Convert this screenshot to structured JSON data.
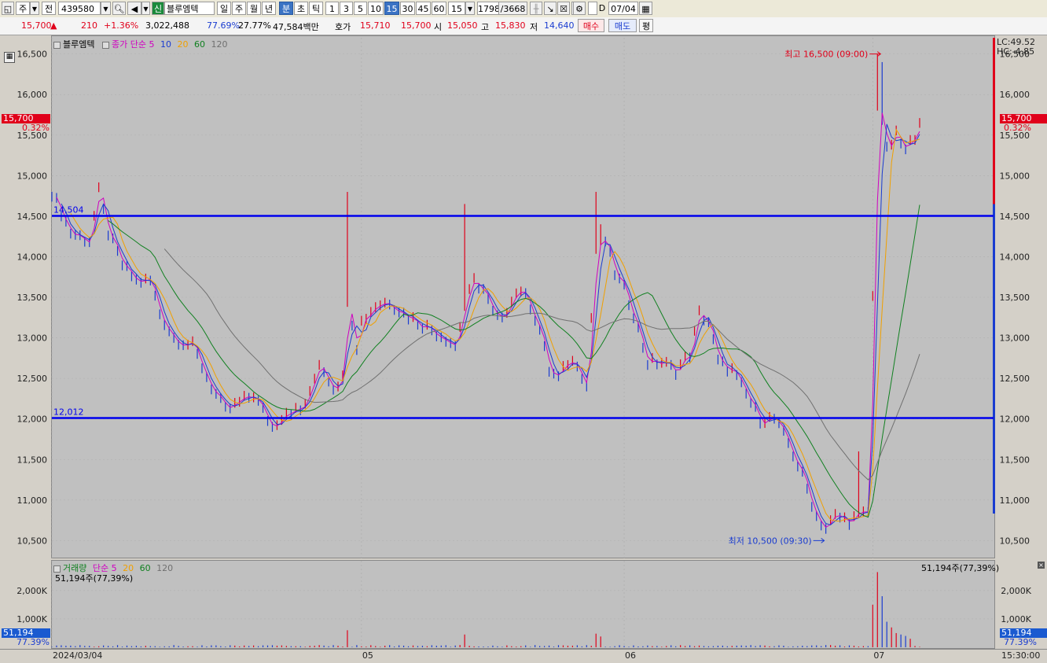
{
  "toolbar": {
    "market": "주",
    "type": "전",
    "code": "439580",
    "credit_badge": "신",
    "stock_name": "블루엠텍",
    "periods": [
      "일",
      "주",
      "월",
      "년",
      "분",
      "초",
      "틱"
    ],
    "minutes": [
      "1",
      "3",
      "5",
      "10",
      "15",
      "30",
      "45",
      "60"
    ],
    "minute_value": "15",
    "count": "1798",
    "total": "/3668",
    "d_label": "D",
    "date": "07/04"
  },
  "quote": {
    "price": "15,700",
    "change": "210",
    "change_pct": "+1.36%",
    "volume": "3,022,488",
    "vol_ratio": "77.69%",
    "turnover": "27.77%",
    "amount": "47,584백만",
    "bid_label": "호가",
    "bid1": "15,710",
    "bid2": "15,700",
    "open_label": "시",
    "open": "15,050",
    "high_label": "고",
    "high": "15,830",
    "low_label": "저",
    "low": "14,640",
    "buy_label": "매수",
    "sell_label": "매도",
    "flat_label": "평"
  },
  "price_legend": {
    "name": "블루엠텍",
    "label": "종가 단순",
    "mas": [
      "5",
      "10",
      "20",
      "60",
      "120"
    ],
    "ma_colors": [
      "#d000c0",
      "#1a3cd0",
      "#f0a000",
      "#108020",
      "#707070"
    ]
  },
  "volume_legend": {
    "name": "거래량",
    "label": "단순",
    "mas": [
      "5",
      "20",
      "60",
      "120"
    ],
    "ma_colors": [
      "#d000c0",
      "#f0a000",
      "#108020",
      "#707070"
    ],
    "current": "51,194주(77,39%)"
  },
  "right_info": {
    "lc": "LC:49.52",
    "hc": "HC:-4.85"
  },
  "current_tag": {
    "price": "15,700",
    "pct": "0.32%"
  },
  "volume_tag": {
    "value": "51,194",
    "pct": "77.39%"
  },
  "time_label": "15:30:00",
  "chart_data": [
    {
      "type": "line",
      "title": "블루엠텍",
      "ylim": [
        10300,
        16700
      ],
      "yticks": [
        "16,500",
        "16,000",
        "15,500",
        "15,000",
        "14,500",
        "14,000",
        "13,500",
        "13,000",
        "12,500",
        "12,000",
        "11,500",
        "11,000",
        "10,500"
      ],
      "ytick_values": [
        16500,
        16000,
        15500,
        15000,
        14500,
        14000,
        13500,
        13000,
        12500,
        12000,
        11500,
        11000,
        10500
      ],
      "x_labels": [
        {
          "label": "2024/03/04",
          "i": 0
        },
        {
          "label": "05",
          "i": 66
        },
        {
          "label": "06",
          "i": 122
        },
        {
          "label": "07",
          "i": 175
        }
      ],
      "n_points": 186,
      "anchors": [
        [
          0,
          14800
        ],
        [
          4,
          14300
        ],
        [
          8,
          14200
        ],
        [
          10,
          14800
        ],
        [
          12,
          14300
        ],
        [
          15,
          13900
        ],
        [
          18,
          13700
        ],
        [
          21,
          13700
        ],
        [
          23,
          13300
        ],
        [
          26,
          13000
        ],
        [
          30,
          12900
        ],
        [
          34,
          12400
        ],
        [
          37,
          12100
        ],
        [
          40,
          12200
        ],
        [
          43,
          12300
        ],
        [
          45,
          12100
        ],
        [
          47,
          11900
        ],
        [
          50,
          12100
        ],
        [
          53,
          12100
        ],
        [
          55,
          12300
        ],
        [
          57,
          12700
        ],
        [
          60,
          12400
        ],
        [
          62,
          12500
        ],
        [
          63,
          13500
        ],
        [
          65,
          12900
        ],
        [
          66,
          13200
        ],
        [
          69,
          13400
        ],
        [
          72,
          13450
        ],
        [
          75,
          13300
        ],
        [
          78,
          13200
        ],
        [
          81,
          13100
        ],
        [
          84,
          13000
        ],
        [
          86,
          12900
        ],
        [
          88,
          13400
        ],
        [
          90,
          13700
        ],
        [
          92,
          13600
        ],
        [
          94,
          13300
        ],
        [
          96,
          13200
        ],
        [
          98,
          13500
        ],
        [
          100,
          13600
        ],
        [
          102,
          13400
        ],
        [
          104,
          13100
        ],
        [
          106,
          12600
        ],
        [
          108,
          12500
        ],
        [
          110,
          12700
        ],
        [
          112,
          12700
        ],
        [
          114,
          12400
        ],
        [
          116,
          14100
        ],
        [
          118,
          14200
        ],
        [
          120,
          13800
        ],
        [
          122,
          13600
        ],
        [
          124,
          13300
        ],
        [
          127,
          12700
        ],
        [
          130,
          12700
        ],
        [
          133,
          12600
        ],
        [
          136,
          12800
        ],
        [
          138,
          13300
        ],
        [
          140,
          13200
        ],
        [
          142,
          12700
        ],
        [
          145,
          12600
        ],
        [
          148,
          12300
        ],
        [
          151,
          12000
        ],
        [
          154,
          12000
        ],
        [
          157,
          11700
        ],
        [
          160,
          11300
        ],
        [
          163,
          10800
        ],
        [
          165,
          10650
        ],
        [
          167,
          10800
        ],
        [
          170,
          10750
        ],
        [
          172,
          10800
        ],
        [
          174,
          10850
        ],
        [
          175,
          13500
        ],
        [
          176,
          15900
        ],
        [
          177,
          15700
        ],
        [
          178,
          15300
        ],
        [
          180,
          15500
        ],
        [
          182,
          15300
        ],
        [
          184,
          15500
        ],
        [
          185,
          15700
        ]
      ],
      "spikes": [
        {
          "i": 63,
          "high": 14800
        },
        {
          "i": 88,
          "high": 14650
        },
        {
          "i": 116,
          "high": 14800
        },
        {
          "i": 117,
          "high": 14400
        },
        {
          "i": 176,
          "high": 16500
        },
        {
          "i": 177,
          "high": 16400
        },
        {
          "i": 172,
          "high": 11600
        }
      ],
      "lines": [
        {
          "value": 14504,
          "label": "14,504"
        },
        {
          "value": 12012,
          "label": "12,012"
        }
      ],
      "annotations": [
        {
          "text": "최고 16,500 (09:00)",
          "i": 177,
          "value": 16500
        },
        {
          "text": "최저 10,500 (09:30)",
          "i": 165,
          "value": 10500
        }
      ],
      "ma_periods": [
        5,
        10,
        20,
        60,
        120
      ]
    },
    {
      "type": "bar",
      "title": "거래량",
      "ylim": [
        0,
        2800
      ],
      "yticks": [
        "2,000K",
        "1,000K"
      ],
      "ytick_values": [
        2000,
        1000
      ],
      "baseline": 80,
      "spikes": [
        {
          "i": 63,
          "v": 600
        },
        {
          "i": 88,
          "v": 450
        },
        {
          "i": 116,
          "v": 480
        },
        {
          "i": 117,
          "v": 380
        },
        {
          "i": 175,
          "v": 1500
        },
        {
          "i": 176,
          "v": 2650
        },
        {
          "i": 177,
          "v": 1800
        },
        {
          "i": 178,
          "v": 900
        },
        {
          "i": 179,
          "v": 700
        },
        {
          "i": 180,
          "v": 500
        },
        {
          "i": 181,
          "v": 450
        },
        {
          "i": 182,
          "v": 400
        },
        {
          "i": 183,
          "v": 300
        }
      ]
    }
  ]
}
